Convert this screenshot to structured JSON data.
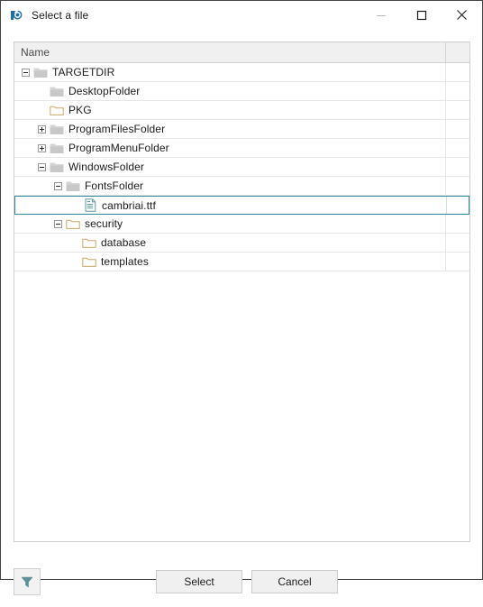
{
  "window": {
    "title": "Select a file",
    "app_icon": "app-logo-icon",
    "accent_color": "#2b8a9b",
    "controls": [
      {
        "name": "minimize",
        "glyph": "minimize-icon",
        "enabled": false
      },
      {
        "name": "maximize",
        "glyph": "maximize-icon",
        "enabled": true
      },
      {
        "name": "close",
        "glyph": "close-icon",
        "enabled": true
      }
    ]
  },
  "tree": {
    "columns": [
      {
        "label": "Name",
        "key": "name"
      },
      {
        "label": "",
        "key": "extra"
      }
    ],
    "rows": [
      {
        "label": "TARGETDIR",
        "depth": 0,
        "expander": "minus",
        "icon": "folder-gray-icon",
        "selected": false
      },
      {
        "label": "DesktopFolder",
        "depth": 1,
        "expander": "none",
        "icon": "folder-gray-icon",
        "selected": false
      },
      {
        "label": "PKG",
        "depth": 1,
        "expander": "none",
        "icon": "folder-open-icon",
        "selected": false
      },
      {
        "label": "ProgramFilesFolder",
        "depth": 1,
        "expander": "plus",
        "icon": "folder-gray-icon",
        "selected": false
      },
      {
        "label": "ProgramMenuFolder",
        "depth": 1,
        "expander": "plus",
        "icon": "folder-gray-icon",
        "selected": false
      },
      {
        "label": "WindowsFolder",
        "depth": 1,
        "expander": "minus",
        "icon": "folder-gray-icon",
        "selected": false
      },
      {
        "label": "FontsFolder",
        "depth": 2,
        "expander": "minus",
        "icon": "folder-gray-icon",
        "selected": false
      },
      {
        "label": "cambriai.ttf",
        "depth": 3,
        "expander": "none",
        "icon": "file-document-icon",
        "selected": true
      },
      {
        "label": "security",
        "depth": 2,
        "expander": "minus",
        "icon": "folder-open-icon",
        "selected": false
      },
      {
        "label": "database",
        "depth": 3,
        "expander": "none",
        "icon": "folder-open-icon",
        "selected": false
      },
      {
        "label": "templates",
        "depth": 3,
        "expander": "none",
        "icon": "folder-open-icon",
        "selected": false
      }
    ]
  },
  "footer": {
    "filter_icon": "filter-funnel-icon",
    "select_label": "Select",
    "cancel_label": "Cancel"
  }
}
